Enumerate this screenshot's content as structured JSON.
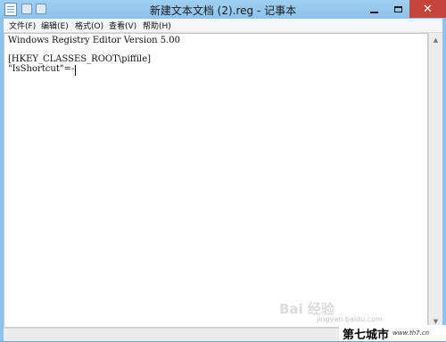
{
  "window": {
    "title": "新建文本文档 (2).reg - 记事本"
  },
  "menu": [
    "文件(F)",
    "编辑(E)",
    "格式(O)",
    "查看(V)",
    "帮助(H)"
  ],
  "editor": {
    "lines": [
      "Windows Registry Editor Version 5.00",
      "",
      "[HKEY_CLASSES_ROOT\\piffile]",
      "\"IsShortcut\"=-"
    ]
  },
  "watermark": {
    "logo_text": "Bai 经验",
    "sub_text": "jingyan.baidu.com"
  },
  "brand": {
    "name": "第七城市",
    "url": "www.th7.cn"
  }
}
